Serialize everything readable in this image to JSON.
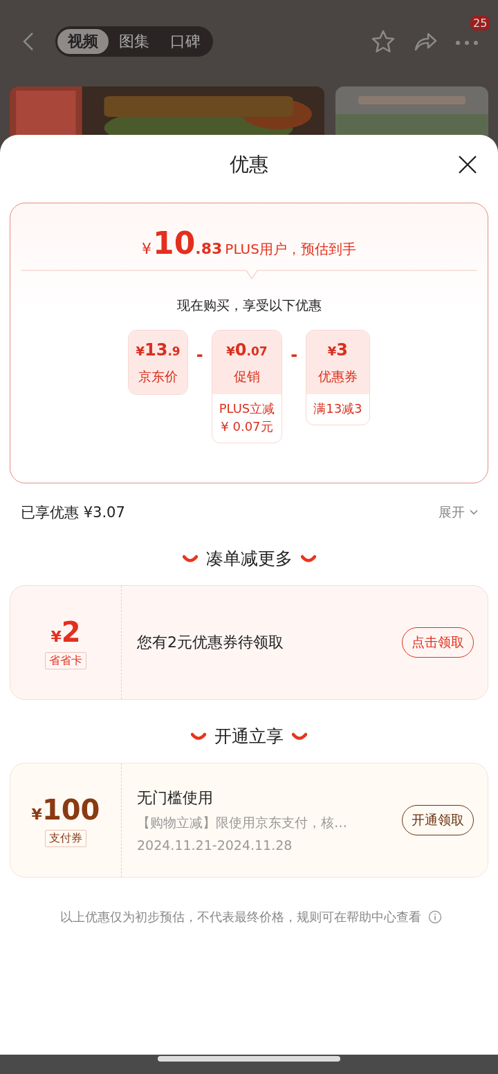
{
  "header": {
    "tabs": [
      {
        "label": "视频",
        "selected": true
      },
      {
        "label": "图集",
        "selected": false
      },
      {
        "label": "口碑",
        "selected": false
      }
    ],
    "badge": "25"
  },
  "sheet": {
    "title": "优惠",
    "estimate": {
      "currency": "¥",
      "integer": "10",
      "decimal": ".83",
      "note": "PLUS用户，预估到手"
    },
    "subtitle": "现在购买，享受以下优惠",
    "breakdown": [
      {
        "currency": "¥",
        "integer": "13",
        "decimal": ".9",
        "label": "京东价"
      },
      {
        "operator": "-",
        "currency": "¥",
        "integer": "0",
        "decimal": ".07",
        "label": "促销",
        "detail": [
          "PLUS立减",
          "¥ 0.07元"
        ]
      },
      {
        "operator": "-",
        "currency": "¥",
        "integer": "3",
        "label": "优惠券",
        "detail": [
          "满13减3"
        ]
      }
    ],
    "saved": {
      "label": "已享优惠 ¥3.07",
      "toggle": "展开"
    },
    "sections": [
      {
        "heading": "凑单减更多",
        "coupon": {
          "kind": "red",
          "currency": "¥",
          "amount": "2",
          "tag": "省省卡",
          "title": "您有2元优惠券待领取",
          "button": "点击领取"
        }
      },
      {
        "heading": "开通立享",
        "coupon": {
          "kind": "gold",
          "currency": "¥",
          "amount": "100",
          "tag": "支付券",
          "title": "无门槛使用",
          "desc": "【购物立减】限使用京东支付，核…",
          "dates": "2024.11.21-2024.11.28",
          "button": "开通领取"
        }
      }
    ],
    "footnote": "以上优惠仅为初步预估，不代表最终价格，规则可在帮助中心查看"
  }
}
